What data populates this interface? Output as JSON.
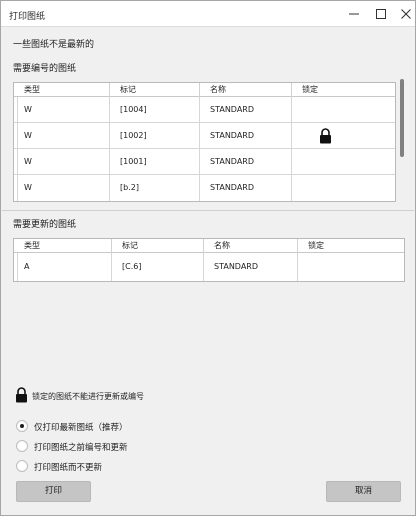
{
  "window": {
    "title": "打印图纸",
    "controls": [
      "minimize-icon",
      "maximize-icon",
      "close-icon"
    ]
  },
  "notice": "一些图纸不是最新的",
  "renumber_section": {
    "title": "需要编号的图纸",
    "columns": [
      "类型",
      "标记",
      "名称",
      "锁定"
    ],
    "rows": [
      {
        "type": "W",
        "mark": "[1004]",
        "name": "STANDARD",
        "locked": false
      },
      {
        "type": "W",
        "mark": "[1002]",
        "name": "STANDARD",
        "locked": true
      },
      {
        "type": "W",
        "mark": "[1001]",
        "name": "STANDARD",
        "locked": false
      },
      {
        "type": "W",
        "mark": "[b.2]",
        "name": "STANDARD",
        "locked": false
      }
    ]
  },
  "update_section": {
    "title": "需要更新的图纸",
    "columns": [
      "类型",
      "标记",
      "名称",
      "锁定"
    ],
    "rows": [
      {
        "type": "A",
        "mark": "[C.6]",
        "name": "STANDARD",
        "locked": false
      }
    ]
  },
  "lock_note": "锁定的图纸不能进行更新或编号",
  "options": [
    {
      "label": "仅打印最新图纸（推荐）",
      "selected": true
    },
    {
      "label": "打印图纸之前编号和更新",
      "selected": false
    },
    {
      "label": "打印图纸而不更新",
      "selected": false
    }
  ],
  "buttons": {
    "print": "打印",
    "cancel": "取消"
  }
}
